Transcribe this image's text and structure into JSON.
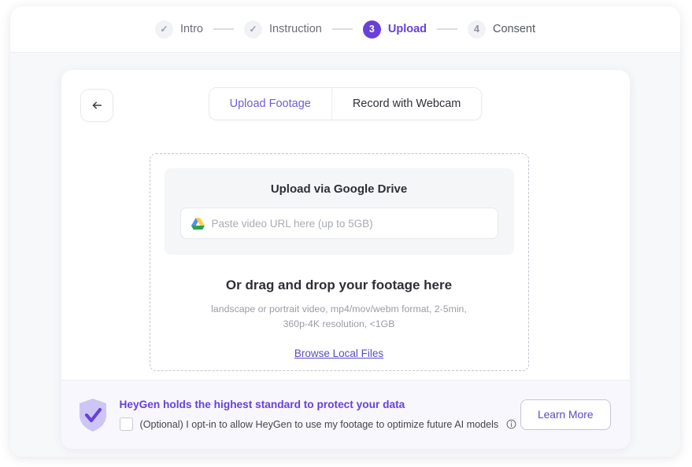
{
  "stepper": {
    "steps": [
      {
        "badge": "✓",
        "label": "Intro",
        "state": "done"
      },
      {
        "badge": "✓",
        "label": "Instruction",
        "state": "done"
      },
      {
        "badge": "3",
        "label": "Upload",
        "state": "active"
      },
      {
        "badge": "4",
        "label": "Consent",
        "state": "todo"
      }
    ]
  },
  "card": {
    "back_icon": "arrow-left-icon",
    "tabs": [
      {
        "label": "Upload Footage",
        "state": "active"
      },
      {
        "label": "Record with Webcam",
        "state": "inactive"
      }
    ]
  },
  "dropzone": {
    "gdrive": {
      "title": "Upload via Google Drive",
      "icon": "google-drive-icon",
      "placeholder": "Paste video URL here (up to 5GB)",
      "value": ""
    },
    "drag_title": "Or drag and drop your footage here",
    "specs_line1": "landscape or portrait video, mp4/mov/webm format, 2-5min,",
    "specs_line2": "360p-4K resolution, <1GB",
    "browse_link": "Browse Local Files"
  },
  "banner": {
    "shield_icon": "shield-check-icon",
    "title": "HeyGen holds the highest standard to protect your data",
    "optin_label": "(Optional) I opt-in to allow HeyGen to use my footage to optimize future AI models",
    "optin_checked": false,
    "info_icon": "info-icon",
    "learn_more": "Learn More"
  },
  "colors": {
    "accent": "#6741d9",
    "accent_light": "#5a4bc4",
    "banner_bg": "#f8f7fd",
    "page_bg": "#f7f8fa",
    "text_dark": "#2e2f36",
    "text_muted": "#9a9ca6"
  },
  "cursor": {
    "type": "pointing-hand-cursor"
  }
}
